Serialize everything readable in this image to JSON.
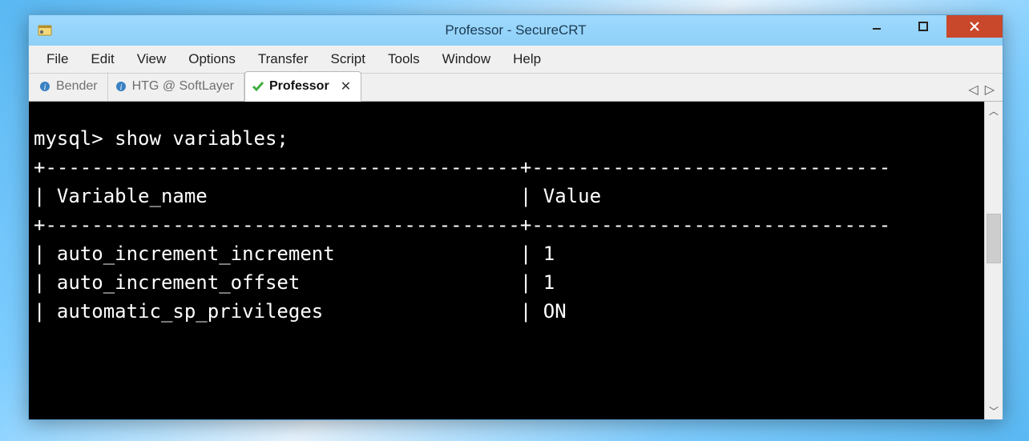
{
  "window": {
    "title": "Professor - SecureCRT"
  },
  "menu": {
    "items": [
      "File",
      "Edit",
      "View",
      "Options",
      "Transfer",
      "Script",
      "Tools",
      "Window",
      "Help"
    ]
  },
  "tabs": {
    "items": [
      {
        "label": "Bender",
        "icon": "info-icon",
        "active": false
      },
      {
        "label": "HTG @ SoftLayer",
        "icon": "info-icon",
        "active": false
      },
      {
        "label": "Professor",
        "icon": "check-icon",
        "active": true
      }
    ]
  },
  "terminal": {
    "prompt": "mysql> show variables;",
    "header_rule": "+-----------------------------------------+-------------------------------",
    "header_row": "| Variable_name                           | Value",
    "rows": [
      {
        "name": "auto_increment_increment",
        "value": "1"
      },
      {
        "name": "auto_increment_offset",
        "value": "1"
      },
      {
        "name": "automatic_sp_privileges",
        "value": "ON"
      }
    ]
  }
}
